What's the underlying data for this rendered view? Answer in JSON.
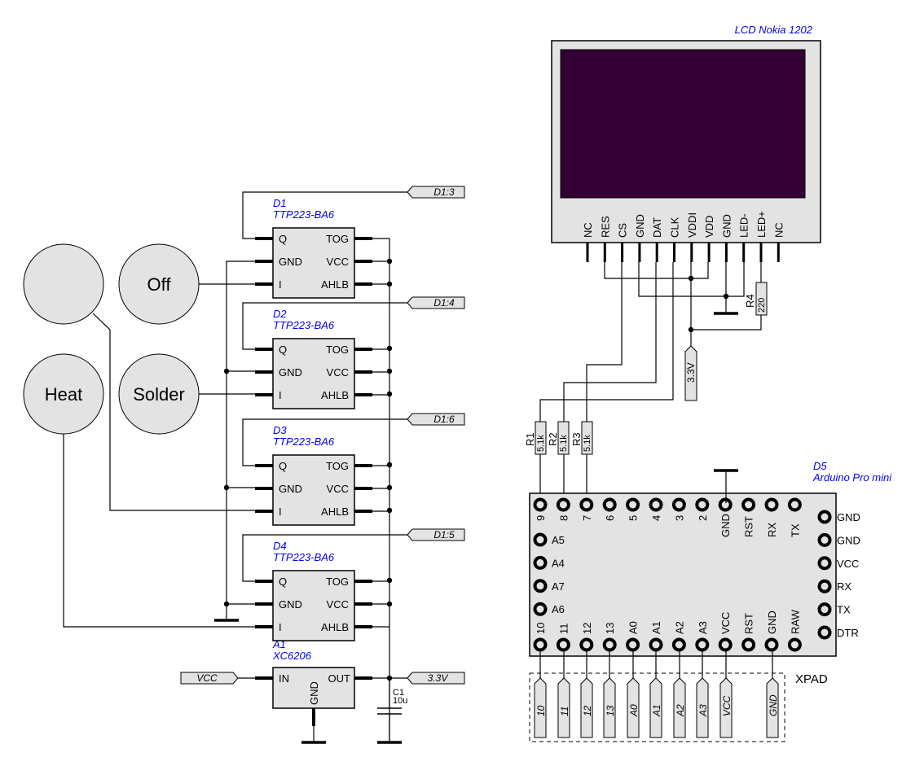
{
  "buttons": [
    {
      "label": ""
    },
    {
      "label": "Off"
    },
    {
      "label": "Heat"
    },
    {
      "label": "Solder"
    }
  ],
  "ttp_chips": [
    {
      "ref": "D1",
      "part": "TTP223-BA6",
      "net": "D1:3",
      "pins_left": [
        "Q",
        "GND",
        "I"
      ],
      "pins_right": [
        "TOG",
        "VCC",
        "AHLB"
      ]
    },
    {
      "ref": "D2",
      "part": "TTP223-BA6",
      "net": "D1:4",
      "pins_left": [
        "Q",
        "GND",
        "I"
      ],
      "pins_right": [
        "TOG",
        "VCC",
        "AHLB"
      ]
    },
    {
      "ref": "D3",
      "part": "TTP223-BA6",
      "net": "D1:6",
      "pins_left": [
        "Q",
        "GND",
        "I"
      ],
      "pins_right": [
        "TOG",
        "VCC",
        "AHLB"
      ]
    },
    {
      "ref": "D4",
      "part": "TTP223-BA6",
      "net": "D1:5",
      "pins_left": [
        "Q",
        "GND",
        "I"
      ],
      "pins_right": [
        "TOG",
        "VCC",
        "AHLB"
      ]
    }
  ],
  "regulator": {
    "ref": "A1",
    "part": "XC6206",
    "pin_in": "IN",
    "pin_out": "OUT",
    "pin_gnd": "GND",
    "net_in": "VCC",
    "net_out": "3.3V"
  },
  "capacitor": {
    "ref": "C1",
    "value": "10u"
  },
  "lcd": {
    "title": "LCD Nokia 1202",
    "screen_color": "#330033",
    "pins": [
      "NC",
      "RES",
      "CS",
      "GND",
      "DAT",
      "CLK",
      "VDDI",
      "VDD",
      "GND",
      "LED-",
      "LED+",
      "NC"
    ]
  },
  "resistors": [
    {
      "ref": "R1",
      "value": "5.1k"
    },
    {
      "ref": "R2",
      "value": "5.1k"
    },
    {
      "ref": "R3",
      "value": "5.1k"
    },
    {
      "ref": "R4",
      "value": "220"
    }
  ],
  "lcd_supply_net": "3.3V",
  "arduino": {
    "ref": "D5",
    "part": "Arduino Pro mini",
    "top_pins": [
      "9",
      "8",
      "7",
      "6",
      "5",
      "4",
      "3",
      "2",
      "GND",
      "RST",
      "RX",
      "TX"
    ],
    "left_pins": [
      "A5",
      "A4",
      "A7",
      "A6"
    ],
    "bottom_pins": [
      "10",
      "11",
      "12",
      "13",
      "A0",
      "A1",
      "A2",
      "A3",
      "VCC",
      "RST",
      "GND",
      "RAW"
    ],
    "right_pins": [
      "GND",
      "GND",
      "VCC",
      "RX",
      "TX",
      "DTR"
    ]
  },
  "xpad": {
    "label": "XPAD",
    "nets": [
      "10",
      "11",
      "12",
      "13",
      "A0",
      "A1",
      "A2",
      "A3",
      "VCC",
      "GND"
    ]
  },
  "colors": {
    "ref_text": "#0000ee",
    "component_fill": "#e3e3e3"
  }
}
